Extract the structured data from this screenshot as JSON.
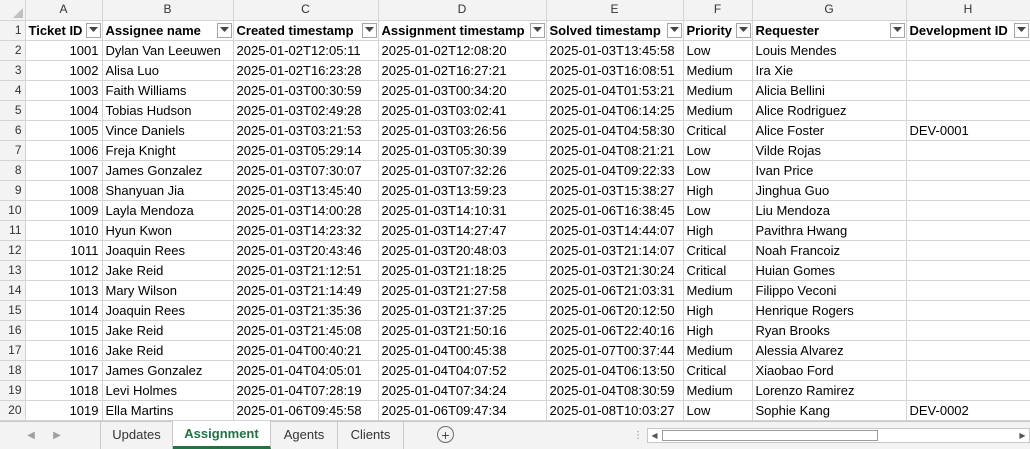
{
  "columns": [
    "A",
    "B",
    "C",
    "D",
    "E",
    "F",
    "G",
    "H"
  ],
  "headers": [
    "Ticket ID",
    "Assignee name",
    "Created timestamp",
    "Assignment timestamp",
    "Solved timestamp",
    "Priority",
    "Requester",
    "Development ID"
  ],
  "rows": [
    [
      "1001",
      "Dylan Van Leeuwen",
      "2025-01-02T12:05:11",
      "2025-01-02T12:08:20",
      "2025-01-03T13:45:58",
      "Low",
      "Louis Mendes",
      ""
    ],
    [
      "1002",
      "Alisa Luo",
      "2025-01-02T16:23:28",
      "2025-01-02T16:27:21",
      "2025-01-03T16:08:51",
      "Medium",
      "Ira Xie",
      ""
    ],
    [
      "1003",
      "Faith Williams",
      "2025-01-03T00:30:59",
      "2025-01-03T00:34:20",
      "2025-01-04T01:53:21",
      "Medium",
      "Alicia Bellini",
      ""
    ],
    [
      "1004",
      "Tobias Hudson",
      "2025-01-03T02:49:28",
      "2025-01-03T03:02:41",
      "2025-01-04T06:14:25",
      "Medium",
      "Alice Rodriguez",
      ""
    ],
    [
      "1005",
      "Vince Daniels",
      "2025-01-03T03:21:53",
      "2025-01-03T03:26:56",
      "2025-01-04T04:58:30",
      "Critical",
      "Alice Foster",
      "DEV-0001"
    ],
    [
      "1006",
      "Freja Knight",
      "2025-01-03T05:29:14",
      "2025-01-03T05:30:39",
      "2025-01-04T08:21:21",
      "Low",
      "Vilde Rojas",
      ""
    ],
    [
      "1007",
      "James Gonzalez",
      "2025-01-03T07:30:07",
      "2025-01-03T07:32:26",
      "2025-01-04T09:22:33",
      "Low",
      "Ivan Price",
      ""
    ],
    [
      "1008",
      "Shanyuan Jia",
      "2025-01-03T13:45:40",
      "2025-01-03T13:59:23",
      "2025-01-03T15:38:27",
      "High",
      "Jinghua Guo",
      ""
    ],
    [
      "1009",
      "Layla Mendoza",
      "2025-01-03T14:00:28",
      "2025-01-03T14:10:31",
      "2025-01-06T16:38:45",
      "Low",
      "Liu Mendoza",
      ""
    ],
    [
      "1010",
      "Hyun Kwon",
      "2025-01-03T14:23:32",
      "2025-01-03T14:27:47",
      "2025-01-03T14:44:07",
      "High",
      "Pavithra Hwang",
      ""
    ],
    [
      "1011",
      "Joaquin Rees",
      "2025-01-03T20:43:46",
      "2025-01-03T20:48:03",
      "2025-01-03T21:14:07",
      "Critical",
      "Noah Francoiz",
      ""
    ],
    [
      "1012",
      "Jake Reid",
      "2025-01-03T21:12:51",
      "2025-01-03T21:18:25",
      "2025-01-03T21:30:24",
      "Critical",
      "Huian Gomes",
      ""
    ],
    [
      "1013",
      "Mary Wilson",
      "2025-01-03T21:14:49",
      "2025-01-03T21:27:58",
      "2025-01-06T21:03:31",
      "Medium",
      "Filippo Veconi",
      ""
    ],
    [
      "1014",
      "Joaquin Rees",
      "2025-01-03T21:35:36",
      "2025-01-03T21:37:25",
      "2025-01-06T20:12:50",
      "High",
      "Henrique Rogers",
      ""
    ],
    [
      "1015",
      "Jake Reid",
      "2025-01-03T21:45:08",
      "2025-01-03T21:50:16",
      "2025-01-06T22:40:16",
      "High",
      "Ryan Brooks",
      ""
    ],
    [
      "1016",
      "Jake Reid",
      "2025-01-04T00:40:21",
      "2025-01-04T00:45:38",
      "2025-01-07T00:37:44",
      "Medium",
      "Alessia Alvarez",
      ""
    ],
    [
      "1017",
      "James Gonzalez",
      "2025-01-04T04:05:01",
      "2025-01-04T04:07:52",
      "2025-01-04T06:13:50",
      "Critical",
      "Xiaobao Ford",
      ""
    ],
    [
      "1018",
      "Levi Holmes",
      "2025-01-04T07:28:19",
      "2025-01-04T07:34:24",
      "2025-01-04T08:30:59",
      "Medium",
      "Lorenzo Ramirez",
      ""
    ],
    [
      "1019",
      "Ella Martins",
      "2025-01-06T09:45:58",
      "2025-01-06T09:47:34",
      "2025-01-08T10:03:27",
      "Low",
      "Sophie Kang",
      "DEV-0002"
    ]
  ],
  "row_numbers": [
    "1",
    "2",
    "3",
    "4",
    "5",
    "6",
    "7",
    "8",
    "9",
    "10",
    "11",
    "12",
    "13",
    "14",
    "15",
    "16",
    "17",
    "18",
    "19",
    "20"
  ],
  "sheet_tabs": [
    {
      "label": "Updates",
      "active": false
    },
    {
      "label": "Assignment",
      "active": true
    },
    {
      "label": "Agents",
      "active": false
    },
    {
      "label": "Clients",
      "active": false
    }
  ],
  "icons": {
    "filter": "filter-dropdown-icon",
    "add_sheet": "plus-circle-icon",
    "scroll_left": "scroll-left-icon",
    "scroll_right": "scroll-right-icon",
    "tab_nav_prev": "chevron-left-icon",
    "tab_nav_next": "chevron-right-icon"
  },
  "colors": {
    "active_tab": "#217346",
    "header_bg": "#f3f3f3",
    "gridline": "#d4d4d4"
  }
}
